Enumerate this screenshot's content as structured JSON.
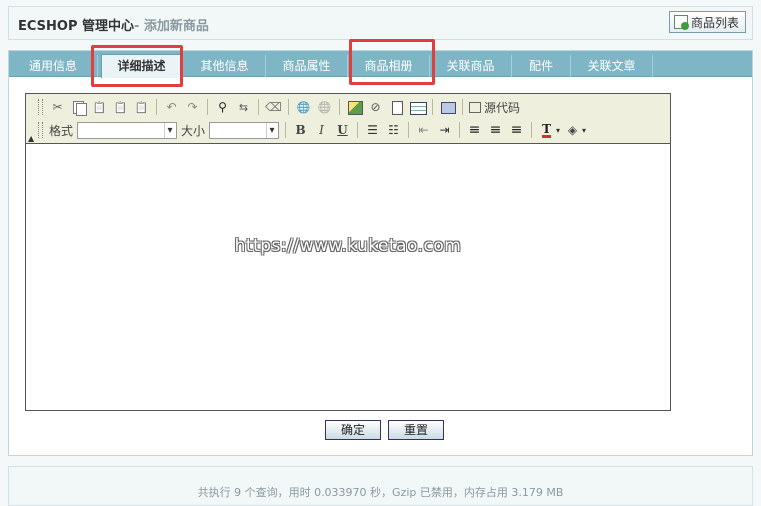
{
  "header": {
    "title": "ECSHOP 管理中心",
    "subtitle": "- 添加新商品",
    "list_button": "商品列表"
  },
  "tabs": [
    {
      "label": "通用信息",
      "active": false
    },
    {
      "label": "详细描述",
      "active": true
    },
    {
      "label": "其他信息",
      "active": false
    },
    {
      "label": "商品属性",
      "active": false
    },
    {
      "label": "商品相册",
      "active": false
    },
    {
      "label": "关联商品",
      "active": false
    },
    {
      "label": "配件",
      "active": false
    },
    {
      "label": "关联文章",
      "active": false
    }
  ],
  "editor": {
    "format_label": "格式",
    "size_label": "大小",
    "source_label": "源代码",
    "bold": "B",
    "italic": "I",
    "underline": "U",
    "watermark": "https://www.kuketao.com"
  },
  "buttons": {
    "confirm": "确定",
    "reset": "重置"
  },
  "footer": {
    "text": "共执行 9 个查询，用时 0.033970 秒，Gzip 已禁用，内存占用 3.179 MB"
  },
  "colors": {
    "tab_bar": "#7fb6c5",
    "highlight": "#e33e3e",
    "toolbar_bg": "#efefde"
  }
}
